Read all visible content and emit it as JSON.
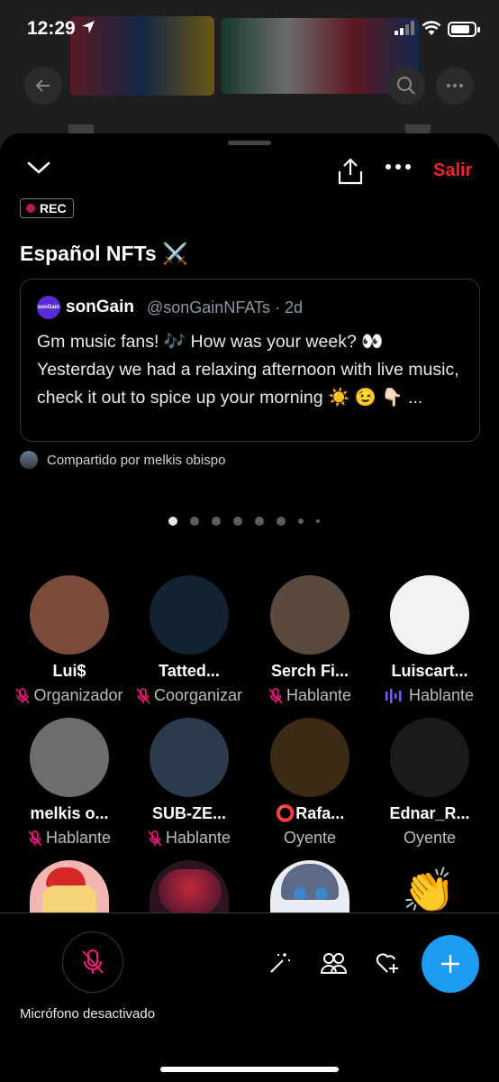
{
  "status_bar": {
    "time": "12:29",
    "battery_level": 0.85
  },
  "space": {
    "recording_badge": "REC",
    "title": "Español NFTs ⚔️",
    "leave_label": "Salir"
  },
  "pinned_tweet": {
    "avatar_text": "sonGain",
    "name": "sonGain",
    "handle": "@sonGainNFATs · 2d",
    "body": "Gm music fans! 🎶 How was your week? 👀 Yesterday we had a relaxing afternoon with live music, check it out to spice up your morning ☀️ 😉 👇🏻 ..."
  },
  "shared_by": "Compartido por melkis obispo",
  "pager": {
    "count": 8,
    "active_index": 0
  },
  "participants": [
    {
      "name": "Lui$",
      "role": "Organizador",
      "mic": "muted",
      "avatar_color": "#7a4a3a"
    },
    {
      "name": "Tatted...",
      "role": "Coorganizar",
      "mic": "muted",
      "avatar_color": "#122230"
    },
    {
      "name": "Serch Fi...",
      "role": "Hablante",
      "mic": "muted",
      "avatar_color": "#5a4a3e"
    },
    {
      "name": "Luiscart...",
      "role": "Hablante",
      "mic": "speaking",
      "avatar_color": "#f2f2f2"
    },
    {
      "name": "melkis o...",
      "role": "Hablante",
      "mic": "muted",
      "avatar_color": "#6d6d6d"
    },
    {
      "name": "SUB-ZE...",
      "role": "Hablante",
      "mic": "muted",
      "avatar_color": "#2b3a4c"
    },
    {
      "name": "⭕Rafa...",
      "role": "Oyente",
      "mic": "none",
      "avatar_color": "#3b2a14"
    },
    {
      "name": "Ednar_R...",
      "role": "Oyente",
      "mic": "none",
      "avatar_color": "#1a1a1a"
    }
  ],
  "bottom_bar": {
    "mic_label": "Micrófono desactivado"
  },
  "colors": {
    "accent": "#1d9bf0",
    "leave": "#f4212e",
    "mic_muted": "#f91880",
    "speaking": "#7856ff"
  }
}
